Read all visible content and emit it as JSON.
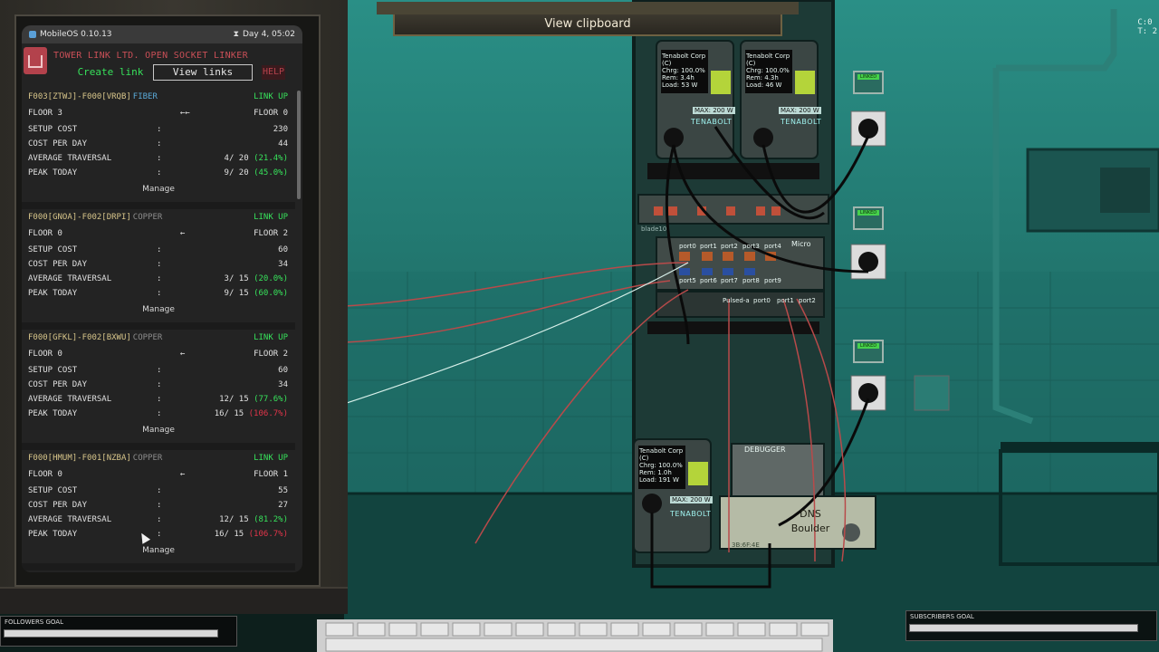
{
  "scene": {
    "clipboard_button": "View clipboard",
    "corner_label": "C:0\nT: 2",
    "power_units": [
      {
        "corp": "Tenabolt Corp\n(C)\nChrg: 100.0%\nRem: 3.4h\nLoad: 53 W",
        "max": "MAX: 200 W",
        "brand": "TENABOLT"
      },
      {
        "corp": "Tenabolt Corp\n(C)\nChrg: 100.0%\nRem: 4.3h\nLoad: 46 W",
        "max": "MAX: 200 W",
        "brand": "TENABOLT"
      },
      {
        "corp": "Tenabolt Corp\n(C)\nChrg: 100.0%\nRem: 1.0h\nLoad: 191 W",
        "max": "MAX: 200 W",
        "brand": "TENABOLT"
      }
    ],
    "router": {
      "ports_top": [
        "port0",
        "port1",
        "port2",
        "port3",
        "port4"
      ],
      "ports_bottom": [
        "port5",
        "port6",
        "port7",
        "port8",
        "port9"
      ],
      "brand": "Micro",
      "blade": "blade10",
      "sub_ports": [
        "port0",
        "port1",
        "port2"
      ],
      "switch_label": "Pulsed-a"
    },
    "wall_leds": [
      "LINKED",
      "LINKED",
      "LINKED"
    ],
    "debugger_label": "DEBUGGER",
    "dns_line1": "DNS",
    "dns_line2": "Boulder",
    "dns_small": "3B:6F:4E"
  },
  "overlays": {
    "followers": {
      "label": "FOLLOWERS GOAL",
      "progress": 1.0
    },
    "subscribers": {
      "label": "SUBSCRIBERS GOAL",
      "progress": 1.0
    }
  },
  "phone": {
    "os": "MobileOS 0.10.13",
    "time": "Day 4, 05:02",
    "app_title": "TOWER LINK LTD. OPEN SOCKET LINKER",
    "create_link": "Create link",
    "view_links": "View links",
    "help": "HELP",
    "manage_label": "Manage",
    "links": [
      {
        "id": "F003[ZTWJ]-F000[VRQB]",
        "cable": "FIBER",
        "status": "LINK UP",
        "from": "FLOOR 3",
        "arrow": "←←",
        "to": "FLOOR 0",
        "setup_cost_label": "SETUP COST",
        "setup_cost": "230",
        "cost_day_label": "COST PER DAY",
        "cost_day": "44",
        "avg_label": "AVERAGE TRAVERSAL",
        "avg": "4/ 20",
        "avg_pct": "(21.4%)",
        "avg_ok": true,
        "peak_label": "PEAK TODAY",
        "peak": "9/ 20",
        "peak_pct": "(45.0%)",
        "peak_ok": true
      },
      {
        "id": "F000[GNOA]-F002[DRPI]",
        "cable": "COPPER",
        "status": "LINK UP",
        "from": "FLOOR 0",
        "arrow": "←",
        "to": "FLOOR 2",
        "setup_cost_label": "SETUP COST",
        "setup_cost": "60",
        "cost_day_label": "COST PER DAY",
        "cost_day": "34",
        "avg_label": "AVERAGE TRAVERSAL",
        "avg": "3/ 15",
        "avg_pct": "(20.0%)",
        "avg_ok": true,
        "peak_label": "PEAK TODAY",
        "peak": "9/ 15",
        "peak_pct": "(60.0%)",
        "peak_ok": true
      },
      {
        "id": "F000[GFKL]-F002[BXWU]",
        "cable": "COPPER",
        "status": "LINK UP",
        "from": "FLOOR 0",
        "arrow": "←",
        "to": "FLOOR 2",
        "setup_cost_label": "SETUP COST",
        "setup_cost": "60",
        "cost_day_label": "COST PER DAY",
        "cost_day": "34",
        "avg_label": "AVERAGE TRAVERSAL",
        "avg": "12/ 15",
        "avg_pct": "(77.6%)",
        "avg_ok": true,
        "peak_label": "PEAK TODAY",
        "peak": "16/ 15",
        "peak_pct": "(106.7%)",
        "peak_ok": false
      },
      {
        "id": "F000[HMUM]-F001[NZBA]",
        "cable": "COPPER",
        "status": "LINK UP",
        "from": "FLOOR 0",
        "arrow": "←",
        "to": "FLOOR 1",
        "setup_cost_label": "SETUP COST",
        "setup_cost": "55",
        "cost_day_label": "COST PER DAY",
        "cost_day": "27",
        "avg_label": "AVERAGE TRAVERSAL",
        "avg": "12/ 15",
        "avg_pct": "(81.2%)",
        "avg_ok": true,
        "peak_label": "PEAK TODAY",
        "peak": "16/ 15",
        "peak_pct": "(106.7%)",
        "peak_ok": false
      }
    ]
  }
}
